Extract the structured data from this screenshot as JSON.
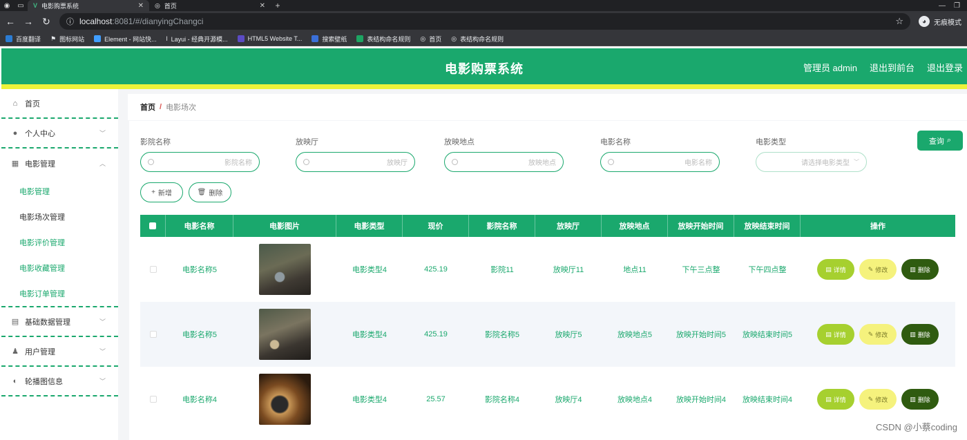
{
  "browser": {
    "tabs": [
      {
        "title": "电影购票系统",
        "active": true
      },
      {
        "title": "首页",
        "active": false
      }
    ],
    "url_host": "localhost",
    "url_path": ":8081/#/dianyingChangci",
    "incognito_label": "无痕模式",
    "bookmarks": [
      "百度翻译",
      "图标网站",
      "Element - 网站快...",
      "Layui - 经典开源模...",
      "HTML5 Website T...",
      "搜索壁纸",
      "表结构命名规则",
      "首页",
      "表结构命名规则"
    ]
  },
  "header": {
    "title": "电影购票系统",
    "admin": "管理员 admin",
    "back_front": "退出到前台",
    "logout": "退出登录",
    "brand_color": "#1aa86d"
  },
  "sidebar": {
    "home": "首页",
    "personal": "个人中心",
    "movie_mgmt": "电影管理",
    "sub_items": [
      "电影管理",
      "电影场次管理",
      "电影评价管理",
      "电影收藏管理",
      "电影订单管理"
    ],
    "base_data": "基础数据管理",
    "user_mgmt": "用户管理",
    "carousel": "轮播图信息"
  },
  "breadcrumb": {
    "home": "首页",
    "sep": "/",
    "current": "电影场次"
  },
  "filters": {
    "cinema_label": "影院名称",
    "cinema_ph": "影院名称",
    "hall_label": "放映厅",
    "hall_ph": "放映厅",
    "place_label": "放映地点",
    "place_ph": "放映地点",
    "movie_label": "电影名称",
    "movie_ph": "电影名称",
    "type_label": "电影类型",
    "type_ph": "请选择电影类型",
    "query": "查询",
    "add": "新增",
    "delete": "删除"
  },
  "table": {
    "columns": [
      "电影名称",
      "电影图片",
      "电影类型",
      "现价",
      "影院名称",
      "放映厅",
      "放映地点",
      "放映开始时间",
      "放映结束时间",
      "操作"
    ],
    "ops": {
      "detail": "详情",
      "edit": "修改",
      "delete": "删除"
    },
    "rows": [
      {
        "name": "电影名称5",
        "type": "电影类型4",
        "price": "425.19",
        "cinema": "影院11",
        "hall": "放映厅11",
        "place": "地点11",
        "start": "下午三点整",
        "end": "下午四点整"
      },
      {
        "name": "电影名称5",
        "type": "电影类型4",
        "price": "425.19",
        "cinema": "影院名称5",
        "hall": "放映厅5",
        "place": "放映地点5",
        "start": "放映开始时间5",
        "end": "放映结束时间5"
      },
      {
        "name": "电影名称4",
        "type": "电影类型4",
        "price": "25.57",
        "cinema": "影院名称4",
        "hall": "放映厅4",
        "place": "放映地点4",
        "start": "放映开始时间4",
        "end": "放映结束时间4"
      }
    ]
  },
  "watermark": "CSDN @小蔡coding"
}
